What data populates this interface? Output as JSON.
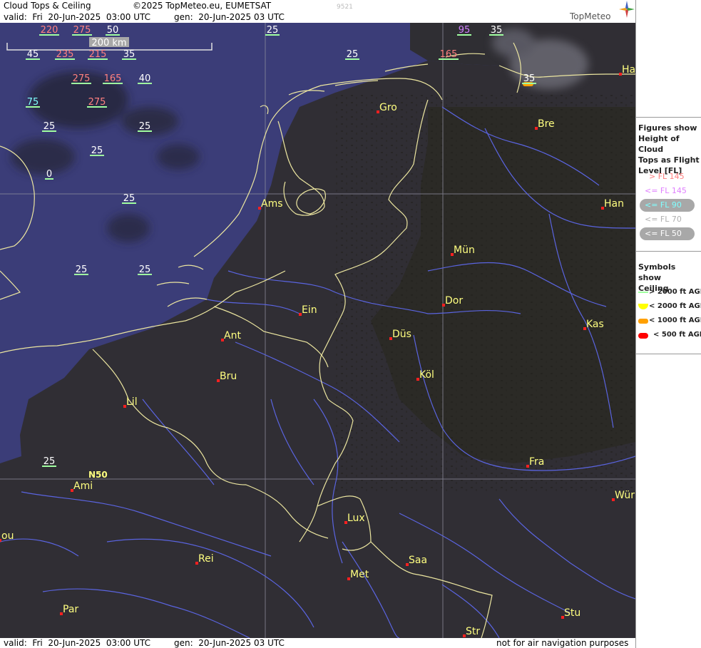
{
  "header": {
    "product": "Cloud Tops & Ceiling",
    "valid": "valid:  Fri  20-Jun-2025  03:00 UTC",
    "copyright": "©2025 TopMeteo.eu, EUMETSAT",
    "generated": "gen:  20-Jun-2025 03 UTC",
    "code": "9521",
    "logo_text": "TopMeteo"
  },
  "footer": {
    "valid": "valid:  Fri  20-Jun-2025  03:00 UTC",
    "generated": "gen:  20-Jun-2025 03 UTC",
    "disclaimer": "not for air navigation purposes"
  },
  "scale_bar": {
    "label": "200 km"
  },
  "grid_labels": {
    "lat": "N50"
  },
  "cities": [
    {
      "name": "Gro"
    },
    {
      "name": "Bre"
    },
    {
      "name": "Ams"
    },
    {
      "name": "Han"
    },
    {
      "name": "Mün"
    },
    {
      "name": "Ein"
    },
    {
      "name": "Dor"
    },
    {
      "name": "Ant"
    },
    {
      "name": "Düs"
    },
    {
      "name": "Kas"
    },
    {
      "name": "Bru"
    },
    {
      "name": "Köl"
    },
    {
      "name": "Lil"
    },
    {
      "name": "Fra"
    },
    {
      "name": "Ami"
    },
    {
      "name": "Wür"
    },
    {
      "name": "Lux"
    },
    {
      "name": "Rei"
    },
    {
      "name": "Saa"
    },
    {
      "name": "Met"
    },
    {
      "name": "Stu"
    },
    {
      "name": "Par"
    },
    {
      "name": "Str"
    },
    {
      "name": "Ha"
    },
    {
      "name": "ou"
    }
  ],
  "cloud_tops": [
    {
      "value": "220",
      "cls": "high"
    },
    {
      "value": "275",
      "cls": "high"
    },
    {
      "value": "50",
      "cls": "low"
    },
    {
      "value": "25",
      "cls": "low"
    },
    {
      "value": "95",
      "cls": "mid"
    },
    {
      "value": "35",
      "cls": "low"
    },
    {
      "value": "45",
      "cls": "low"
    },
    {
      "value": "235",
      "cls": "high"
    },
    {
      "value": "215",
      "cls": "high"
    },
    {
      "value": "35",
      "cls": "low"
    },
    {
      "value": "25",
      "cls": "low"
    },
    {
      "value": "165",
      "cls": "high"
    },
    {
      "value": "275",
      "cls": "high"
    },
    {
      "value": "165",
      "cls": "high"
    },
    {
      "value": "40",
      "cls": "low"
    },
    {
      "value": "35",
      "cls": "low"
    },
    {
      "value": "75",
      "cls": "fl90"
    },
    {
      "value": "275",
      "cls": "high"
    },
    {
      "value": "25",
      "cls": "low"
    },
    {
      "value": "25",
      "cls": "low"
    },
    {
      "value": "25",
      "cls": "low"
    },
    {
      "value": "0",
      "cls": "low"
    },
    {
      "value": "25",
      "cls": "low"
    },
    {
      "value": "25",
      "cls": "low"
    },
    {
      "value": "25",
      "cls": "low"
    },
    {
      "value": "25",
      "cls": "low"
    }
  ],
  "legend": {
    "title": "Figures show Height of Cloud Tops as Flight Level  [FL]",
    "title_lines": [
      "Figures show",
      "Height of Cloud",
      "Tops as Flight",
      "Level  [FL]"
    ],
    "levels": [
      {
        "label": "> FL 145",
        "color": "#ff8080"
      },
      {
        "label": "<= FL 145",
        "color": "#e080ff"
      },
      {
        "label": "<= FL 90",
        "color": "#80ffff"
      },
      {
        "label": "<= FL 70",
        "color": "#c8c8c8"
      },
      {
        "label": "<= FL 50",
        "color": "#ffffff"
      }
    ],
    "ceiling_title_lines": [
      "Symbols show",
      "Ceiling"
    ],
    "ceiling": [
      {
        "label": "> 2000 ft AGL",
        "color": "#a0ffa0"
      },
      {
        "label": "< 2000 ft AGL",
        "color": "#ffff00"
      },
      {
        "label": "< 1000 ft AGL",
        "color": "#ffa000"
      },
      {
        "label": "< 500 ft AGL",
        "color": "#ff0000"
      }
    ]
  },
  "colors": {
    "land": "#2e2d2a",
    "sea": "#3b3d78",
    "border": "#ece6a0",
    "river": "#5a64e0",
    "city_text": "#ffff80",
    "city_dot": "#ff2020"
  }
}
